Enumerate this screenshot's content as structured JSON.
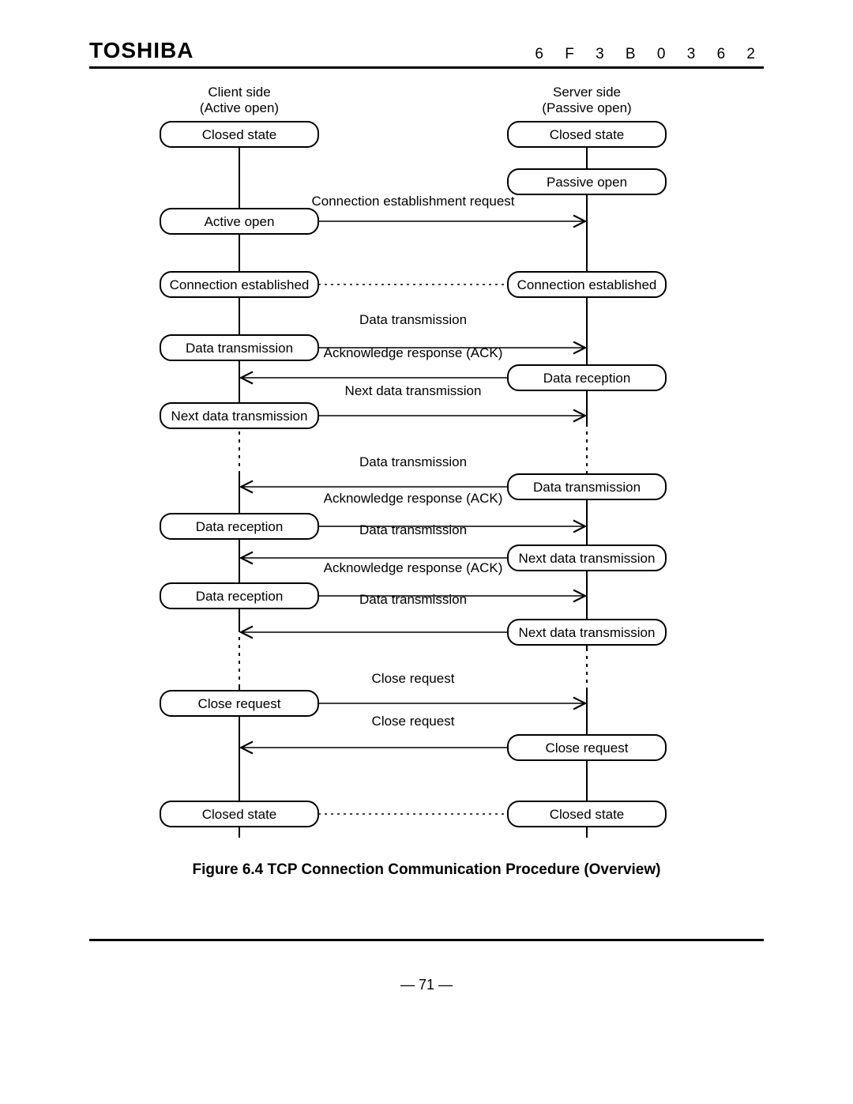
{
  "brand": "TOSHIBA",
  "docId": "6 F 3 B 0 3 6 2",
  "pageNumber": "—  71  —",
  "caption": "Figure 6.4    TCP Connection Communication Procedure (Overview)",
  "headers": {
    "clientLine1": "Client side",
    "clientLine2": "(Active open)",
    "serverLine1": "Server side",
    "serverLine2": "(Passive open)"
  },
  "client": {
    "s0": "Closed state",
    "s1": "Active open",
    "s2": "Connection established",
    "s3": "Data transmission",
    "s4": "Next data transmission",
    "s5": "Data reception",
    "s6": "Data reception",
    "s7": "Close request",
    "s8": "Closed state"
  },
  "server": {
    "s0": "Closed state",
    "s1": "Passive open",
    "s2": "Connection established",
    "s3": "Data reception",
    "s4": "Data transmission",
    "s5": "Next data transmission",
    "s6": "Next data transmission",
    "s7": "Close request",
    "s8": "Closed state"
  },
  "msg": {
    "m1": "Connection establishment request",
    "m2": "Data transmission",
    "m3": "Acknowledge response (ACK)",
    "m4": "Next data transmission",
    "m5": "Data transmission",
    "m6": "Acknowledge response (ACK)",
    "m7": "Data transmission",
    "m8": "Acknowledge response (ACK)",
    "m9": "Data transmission",
    "m10": "Close request",
    "m11": "Close request"
  }
}
